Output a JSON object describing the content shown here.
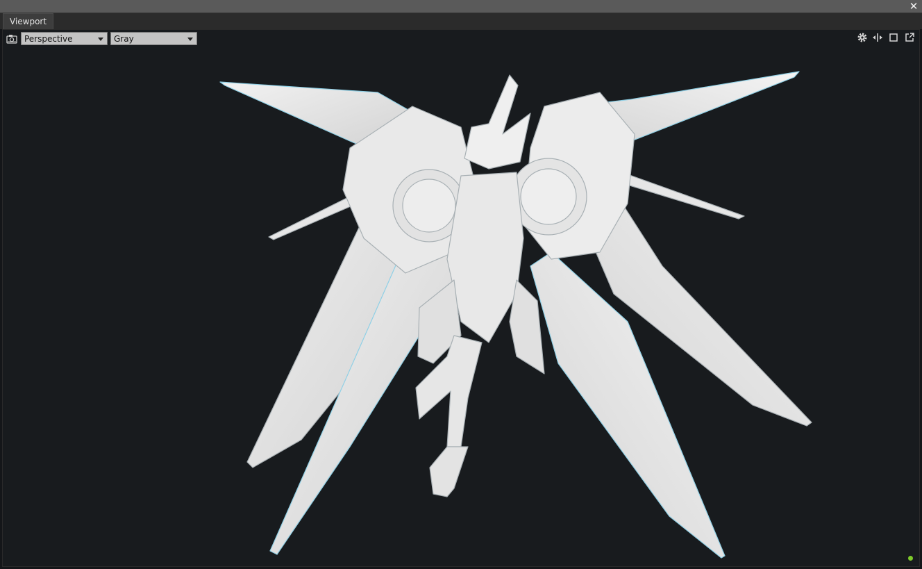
{
  "window": {
    "close_symbol": "✕"
  },
  "tabs": [
    {
      "label": "Viewport"
    }
  ],
  "viewport": {
    "camera_icon": "camera-icon",
    "projection": {
      "selected": "Perspective"
    },
    "shading": {
      "selected": "Gray"
    },
    "right_icons": [
      "gear-icon",
      "split-view-icon",
      "maximize-icon",
      "popout-icon"
    ],
    "status_color": "#7ecb2a"
  }
}
